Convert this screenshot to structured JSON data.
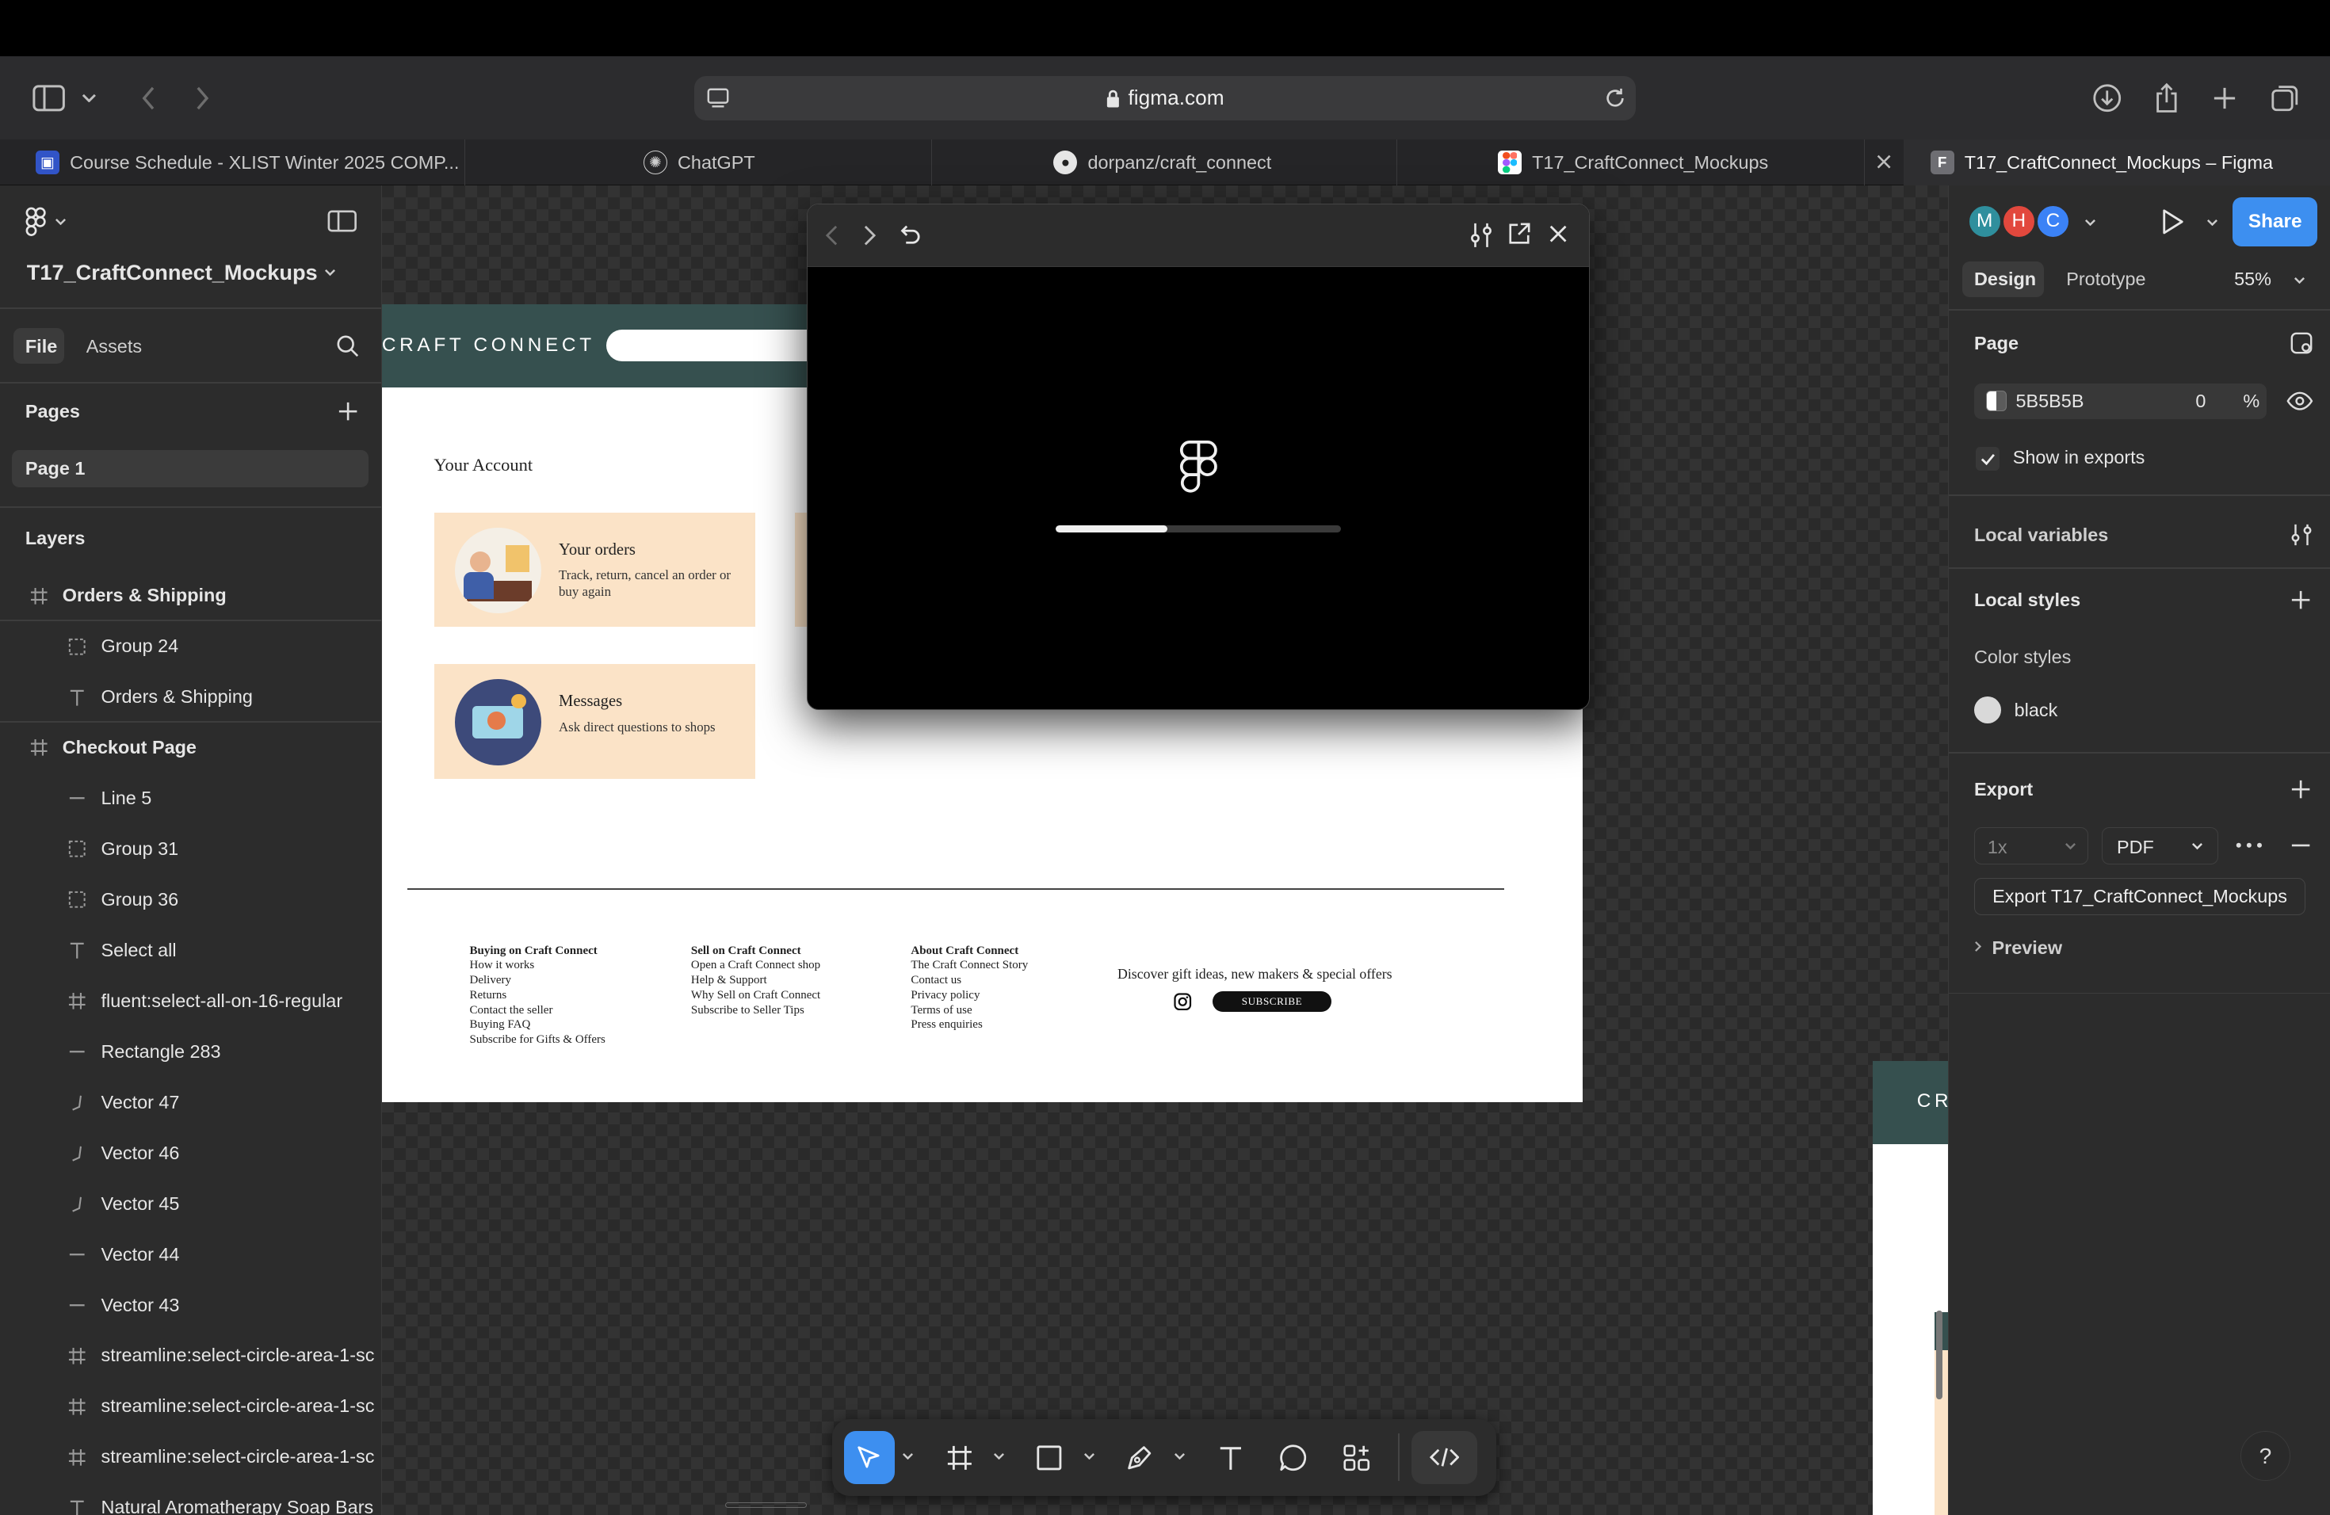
{
  "browser": {
    "url": "figma.com",
    "tabs": [
      {
        "title": "Course Schedule - XLIST Winter 2025 COMP..."
      },
      {
        "title": "ChatGPT"
      },
      {
        "title": "dorpanz/craft_connect"
      },
      {
        "title": "T17_CraftConnect_Mockups"
      },
      {
        "title": "T17_CraftConnect_Mockups – Figma"
      }
    ]
  },
  "left_panel": {
    "file_name": "T17_CraftConnect_Mockups",
    "tab_file": "File",
    "tab_assets": "Assets",
    "pages_label": "Pages",
    "current_page": "Page 1",
    "layers_label": "Layers",
    "layers": [
      {
        "name": "Orders & Shipping",
        "icon": "frame-icon"
      },
      {
        "name": "Group 24",
        "icon": "group-icon"
      },
      {
        "name": "Orders & Shipping",
        "icon": "text-icon"
      },
      {
        "name": "Checkout Page",
        "icon": "frame-icon"
      },
      {
        "name": "Line 5",
        "icon": "line-icon"
      },
      {
        "name": "Group 31",
        "icon": "group-icon"
      },
      {
        "name": "Group 36",
        "icon": "group-icon"
      },
      {
        "name": "Select all",
        "icon": "text-icon"
      },
      {
        "name": "fluent:select-all-on-16-regular",
        "icon": "frame-icon"
      },
      {
        "name": "Rectangle 283",
        "icon": "line-icon"
      },
      {
        "name": "Vector 47",
        "icon": "vector-icon"
      },
      {
        "name": "Vector 46",
        "icon": "vector-icon"
      },
      {
        "name": "Vector 45",
        "icon": "vector-icon"
      },
      {
        "name": "Vector 44",
        "icon": "line-icon"
      },
      {
        "name": "Vector 43",
        "icon": "line-icon"
      },
      {
        "name": "streamline:select-circle-area-1-sc",
        "icon": "frame-icon"
      },
      {
        "name": "streamline:select-circle-area-1-sc",
        "icon": "frame-icon"
      },
      {
        "name": "streamline:select-circle-area-1-sc",
        "icon": "frame-icon"
      },
      {
        "name": "Natural Aromatherapy Soap Bars",
        "icon": "text-icon"
      }
    ]
  },
  "canvas": {
    "site_brand": "CRAFT CONNECT",
    "site_brand_2": "CRA",
    "account_title": "Your Account",
    "cards": [
      {
        "title": "Your orders",
        "desc": "Track, return, cancel an order or buy again"
      },
      {
        "title": "Messages",
        "desc": "Ask direct questions to shops"
      }
    ],
    "footer": {
      "col1_title": "Buying on Craft Connect",
      "col1": [
        "How it works",
        "Delivery",
        "Returns",
        "Contact the seller",
        "Buying FAQ",
        "Subscribe for Gifts & Offers"
      ],
      "col2_title": "Sell on Craft Connect",
      "col2": [
        "Open a Craft Connect shop",
        "Help & Support",
        "Why Sell on Craft Connect",
        "Subscribe to Seller Tips"
      ],
      "col3_title": "About Craft Connect",
      "col3": [
        "The Craft Connect Story",
        "Contact us",
        "Privacy policy",
        "Terms of use",
        "Press enquiries"
      ],
      "promo": "Discover gift ideas, new makers & special offers",
      "subscribe": "SUBSCRIBE"
    }
  },
  "prototype_modal": {
    "loading_progress": 0.39
  },
  "right_panel": {
    "avatars": [
      {
        "letter": "M",
        "color": "#2f8f9d"
      },
      {
        "letter": "H",
        "color": "#e2483d"
      },
      {
        "letter": "C",
        "color": "#3b82f6"
      }
    ],
    "share_label": "Share",
    "tab_design": "Design",
    "tab_prototype": "Prototype",
    "zoom": "55%",
    "page_label": "Page",
    "page_color": "5B5B5B",
    "page_opacity": "0",
    "percent_sign": "%",
    "show_in_exports": "Show in exports",
    "local_variables": "Local variables",
    "local_styles": "Local styles",
    "color_styles": "Color styles",
    "color_style_name": "black",
    "export_label": "Export",
    "export_scale": "1x",
    "export_format": "PDF",
    "export_button": "Export T17_CraftConnect_Mockups",
    "preview_label": "Preview"
  },
  "help_label": "?"
}
